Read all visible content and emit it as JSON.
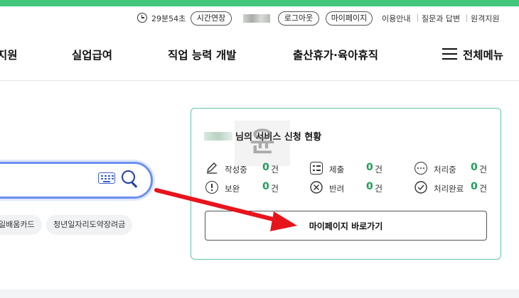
{
  "colors": {
    "brand_green": "#43c77a",
    "card_border": "#5fc79a",
    "count_green": "#1f9d57",
    "search_border": "#6b8ff0",
    "arrow_red": "#e8141c"
  },
  "util_bar": {
    "timer": "29분54초",
    "extend_label": "시간연장",
    "logout_label": "로그아웃",
    "mypage_label": "마이페이지",
    "links": [
      "이용안내",
      "질문과 답변",
      "원격지원"
    ]
  },
  "nav": {
    "items": [
      "지원",
      "실업급여",
      "직업 능력 개발",
      "출산휴가·육아휴직"
    ],
    "menu_label": "전체메뉴"
  },
  "search": {
    "tags": [
      "일배움카드",
      "청년일자리도약장려금"
    ]
  },
  "card": {
    "title": "님의 서비스 신청 현황",
    "watermark": "윤",
    "unit": "건",
    "statuses": [
      {
        "label": "작성중",
        "count": "0",
        "icon": "pencil-icon"
      },
      {
        "label": "제출",
        "count": "0",
        "icon": "checklist-icon"
      },
      {
        "label": "처리중",
        "count": "0",
        "icon": "ellipsis-circle-icon"
      },
      {
        "label": "보완",
        "count": "0",
        "icon": "exclamation-circle-icon"
      },
      {
        "label": "반려",
        "count": "0",
        "icon": "x-circle-icon"
      },
      {
        "label": "처리완료",
        "count": "0",
        "icon": "check-circle-icon"
      }
    ],
    "button_label": "마이페이지 바로가기"
  }
}
